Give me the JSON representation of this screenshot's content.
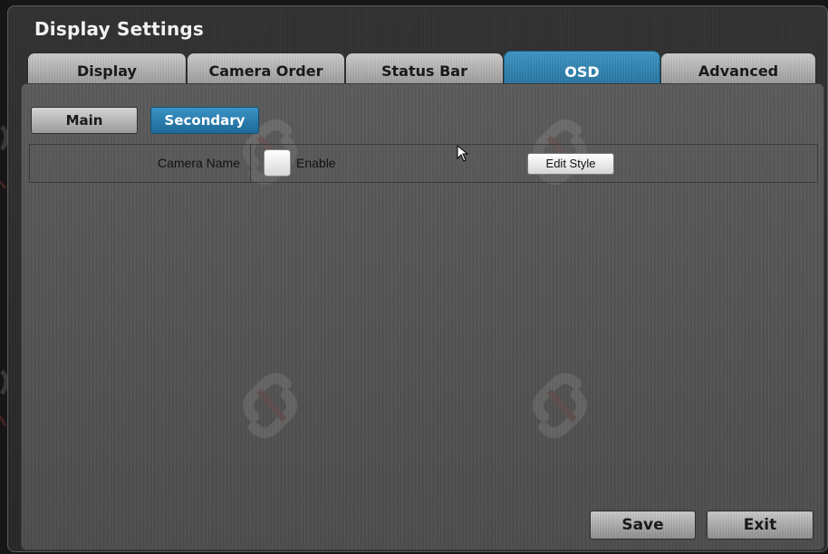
{
  "window": {
    "title": "Display Settings"
  },
  "tabs": [
    {
      "label": "Display",
      "active": false
    },
    {
      "label": "Camera Order",
      "active": false
    },
    {
      "label": "Status Bar",
      "active": false
    },
    {
      "label": "OSD",
      "active": true
    },
    {
      "label": "Advanced",
      "active": false
    }
  ],
  "subtabs": [
    {
      "label": "Main",
      "active": false
    },
    {
      "label": "Secondary",
      "active": true
    }
  ],
  "settings_row": {
    "label": "Camera Name",
    "checkbox_checked": false,
    "checkbox_label": "Enable",
    "edit_button_label": "Edit Style"
  },
  "footer": {
    "save_label": "Save",
    "exit_label": "Exit"
  },
  "colors": {
    "accent": "#2a80b3",
    "tab_inactive": "#b0b0b0",
    "panel": "#555555"
  },
  "icons": {
    "watermark": "logo-watermark-icon",
    "cursor": "mouse-pointer-icon"
  }
}
